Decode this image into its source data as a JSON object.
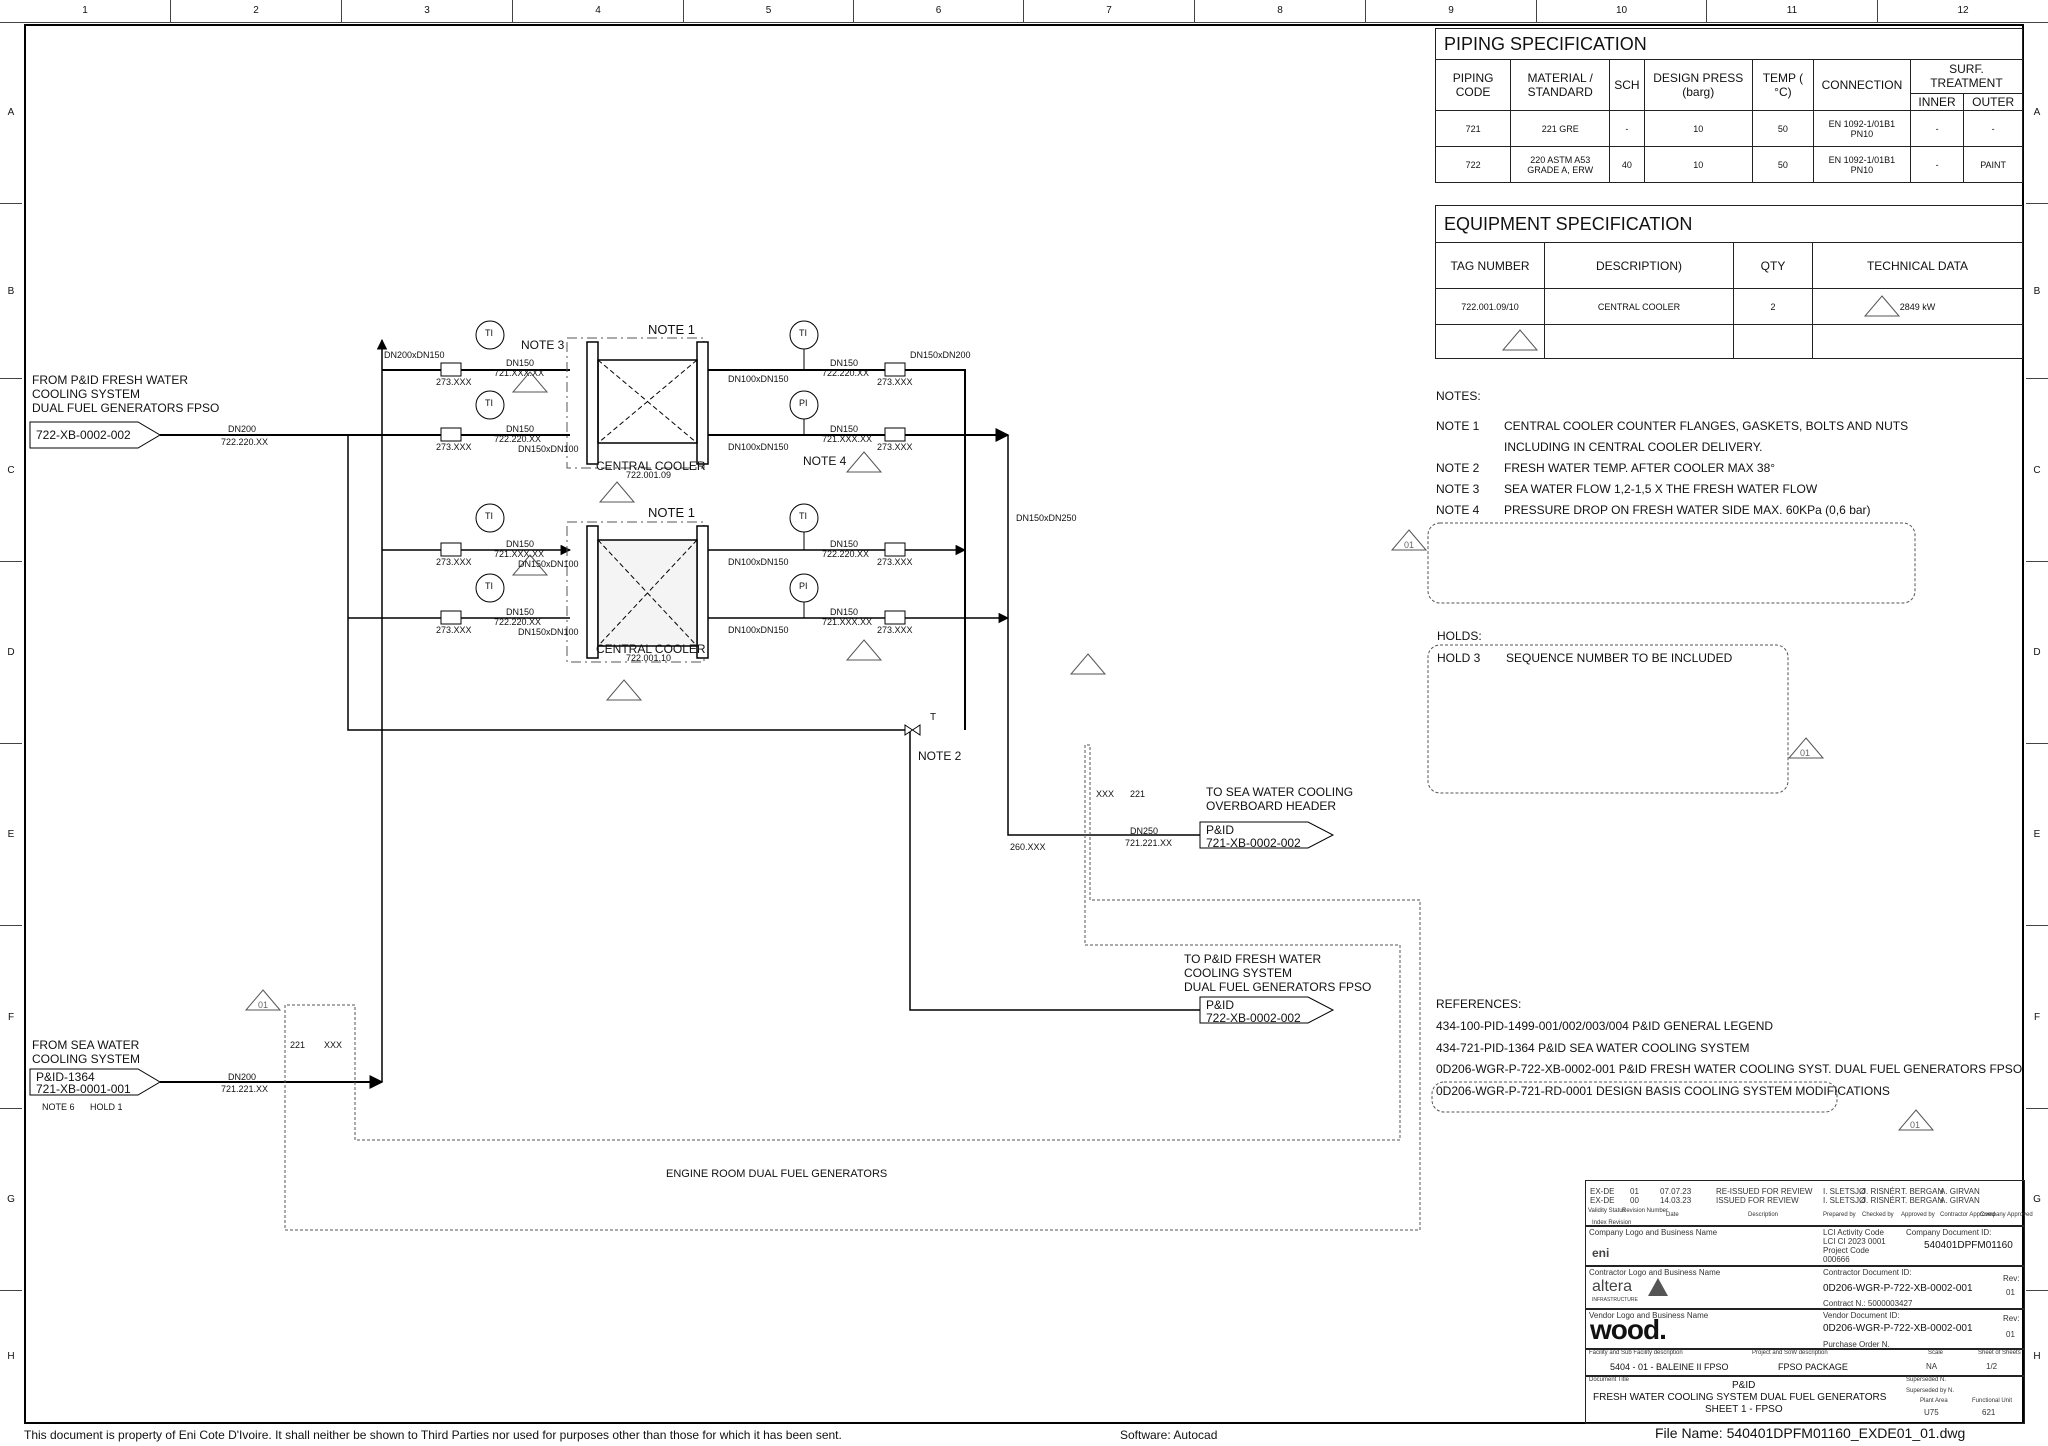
{
  "zones": {
    "columns": [
      "1",
      "2",
      "3",
      "4",
      "5",
      "6",
      "7",
      "8",
      "9",
      "10",
      "11",
      "12"
    ],
    "rows": [
      "A",
      "B",
      "C",
      "D",
      "E",
      "F",
      "G",
      "H"
    ]
  },
  "piping_spec": {
    "title": "PIPING SPECIFICATION",
    "headers": {
      "code": "PIPING CODE",
      "material": "MATERIAL / STANDARD",
      "sch": "SCH",
      "press": "DESIGN PRESS (barg)",
      "temp": "TEMP ( °C)",
      "connection": "CONNECTION",
      "surf": "SURF. TREATMENT",
      "inner": "INNER",
      "outer": "OUTER"
    },
    "rows": [
      {
        "code": "721",
        "material": "221 GRE",
        "sch": "-",
        "press": "10",
        "temp": "50",
        "connection": "EN 1092-1/01B1 PN10",
        "inner": "-",
        "outer": "-"
      },
      {
        "code": "722",
        "material": "220 ASTM A53 GRADE A, ERW",
        "sch": "40",
        "press": "10",
        "temp": "50",
        "connection": "EN 1092-1/01B1 PN10",
        "inner": "-",
        "outer": "PAINT"
      }
    ]
  },
  "equipment_spec": {
    "title": "EQUIPMENT SPECIFICATION",
    "headers": {
      "tag": "TAG NUMBER",
      "desc": "DESCRIPTION)",
      "qty": "QTY",
      "tech": "TECHNICAL DATA"
    },
    "rows": [
      {
        "tag": "722.001.09/10",
        "desc": "CENTRAL COOLER",
        "qty": "2",
        "tech": "2849 kW"
      }
    ]
  },
  "notes": {
    "title": "NOTES:",
    "items": [
      {
        "label": "NOTE 1",
        "text": "CENTRAL COOLER COUNTER FLANGES, GASKETS, BOLTS AND NUTS"
      },
      {
        "label": "",
        "text": "INCLUDING IN CENTRAL COOLER DELIVERY."
      },
      {
        "label": "NOTE 2",
        "text": "FRESH WATER TEMP. AFTER COOLER MAX 38°"
      },
      {
        "label": "NOTE 3",
        "text": "SEA WATER FLOW 1,2-1,5 X THE FRESH WATER FLOW"
      },
      {
        "label": "NOTE 4",
        "text": "PRESSURE DROP ON FRESH WATER SIDE MAX. 60KPa (0,6 bar)"
      }
    ]
  },
  "holds": {
    "title": "HOLDS:",
    "items": [
      {
        "label": "HOLD 3",
        "text": "SEQUENCE NUMBER TO BE INCLUDED"
      }
    ]
  },
  "references": {
    "title": "REFERENCES:",
    "items": [
      "434-100-PID-1499-001/002/003/004 P&ID GENERAL LEGEND",
      "434-721-PID-1364 P&ID SEA WATER COOLING SYSTEM",
      "0D206-WGR-P-722-XB-0002-001 P&ID FRESH WATER COOLING SYST. DUAL FUEL GENERATORS FPSO",
      "0D206-WGR-P-721-RD-0001 DESIGN BASIS COOLING SYSTEM MODIFICATIONS"
    ]
  },
  "revision_marker": "01",
  "diagram": {
    "from_fw": {
      "lines": [
        "FROM P&ID FRESH WATER",
        "COOLING SYSTEM",
        "DUAL FUEL GENERATORS FPSO"
      ],
      "ref": "722-XB-0002-002"
    },
    "from_sw": {
      "lines": [
        "FROM SEA WATER",
        "COOLING SYSTEM"
      ],
      "ref1": "P&ID-1364",
      "ref2": "721-XB-0001-001",
      "note": "NOTE 6",
      "hold": "HOLD 1"
    },
    "to_sw": {
      "lines": [
        "TO SEA WATER COOLING",
        "OVERBOARD HEADER"
      ],
      "ref1": "P&ID",
      "ref2": "721-XB-0002-002"
    },
    "to_fw": {
      "lines": [
        "TO P&ID FRESH WATER",
        "COOLING SYSTEM",
        "DUAL FUEL GENERATORS FPSO"
      ],
      "ref1": "P&ID",
      "ref2": "722-XB-0002-002"
    },
    "engine_room": "ENGINE ROOM DUAL FUEL GENERATORS",
    "coolers": [
      {
        "name": "CENTRAL COOLER",
        "tag": "722.001.09",
        "note": "NOTE 1"
      },
      {
        "name": "CENTRAL COOLER",
        "tag": "722.001.10",
        "note": "NOTE 1"
      }
    ],
    "labels": {
      "note2": "NOTE 2",
      "note3": "NOTE 3",
      "note4": "NOTE 4",
      "dn200": "DN200",
      "dn150": "DN150",
      "dn250": "DN250",
      "line_722_220": "722.220.XX",
      "line_721_xxx": "721.XXX.XX",
      "line_721_221": "721.221.XX",
      "line_721_vert": "721.XXX.XX",
      "red_200_150": "DN200xDN150",
      "red_150_100": "DN150xDN100",
      "red_100_150": "DN100xDN150",
      "red_150_200": "DN150xDN200",
      "red_150_250": "DN150xDN250",
      "valve": "273.XXX",
      "check_valve": "260.XXX",
      "spec_221": "221",
      "spec_xxx": "XXX",
      "ti": "TI",
      "pi": "PI",
      "t": "T"
    }
  },
  "title_block": {
    "revisions": [
      {
        "status": "EX-DE",
        "rev": "01",
        "date": "07.07.23",
        "desc": "RE-ISSUED FOR REVIEW",
        "prepared": "I. SLETSJØ",
        "checked": "J. RISNÉR",
        "approved": "T. BERGAN",
        "contractor": "A. GIRVAN"
      },
      {
        "status": "EX-DE",
        "rev": "00",
        "date": "14.03.23",
        "desc": "ISSUED FOR REVIEW",
        "prepared": "I. SLETSJØ",
        "checked": "J. RISNÉR",
        "approved": "T. BERGAN",
        "contractor": "A. GIRVAN"
      }
    ],
    "rev_headers": {
      "status": "Validity Status",
      "rev": "Revision Number",
      "date": "Date",
      "desc": "Description",
      "prepared": "Prepared by",
      "checked": "Checked by",
      "approved": "Approved by",
      "contractor": "Contractor Approved",
      "company": "Company Approved",
      "index": "Index Revision"
    },
    "company_logo_label": "Company Logo and Business Name",
    "company_name": "eni",
    "lci_label": "LCI Activity Code",
    "lci_value": "LCI CI 2023 0001",
    "project_code_label": "Project Code",
    "project_code": "000666",
    "company_doc_label": "Company Document ID:",
    "company_doc": "540401DPFM01160",
    "contractor_logo_label": "Contractor Logo and Business Name",
    "contractor_name": "altera",
    "contractor_sub": "INFRASTRUCTURE",
    "contractor_doc_label": "Contractor Document ID:",
    "contractor_doc": "0D206-WGR-P-722-XB-0002-001",
    "contract_no": "Contract N.: 5000003427",
    "rev_label": "Rev:",
    "rev_value": "01",
    "vendor_logo_label": "Vendor Logo and Business Name",
    "vendor_name": "wood.",
    "vendor_doc_label": "Vendor Document ID:",
    "vendor_doc": "0D206-WGR-P-722-XB-0002-001",
    "purchase_order": "Purchase Order N.",
    "facility_label": "Facility and Sub Facility description",
    "facility": "5404 - 01 - BALEINE II FPSO",
    "project_label": "Project and SoW description",
    "project": "FPSO PACKAGE",
    "scale_label": "Scale",
    "scale": "NA",
    "sheet_label": "Sheet of Sheets",
    "sheet": "1/2",
    "doc_title_label": "Document Title",
    "doc_title_1": "P&ID",
    "doc_title_2": "FRESH WATER COOLING SYSTEM DUAL FUEL GENERATORS",
    "doc_title_3": "SHEET 1 - FPSO",
    "superseded": "Superseded N.",
    "superseded_by": "Superseded by N.",
    "plant_area_label": "Plant Area",
    "plant_area": "U75",
    "functional_unit_label": "Functional Unit",
    "functional_unit": "621"
  },
  "footer": {
    "disclaimer": "This document is property of Eni Cote D'Ivoire. It shall neither be shown to Third Parties nor used for purposes other than those for which it has been sent.",
    "software": "Software: Autocad",
    "file_name": "File Name: 540401DPFM01160_EXDE01_01.dwg"
  }
}
